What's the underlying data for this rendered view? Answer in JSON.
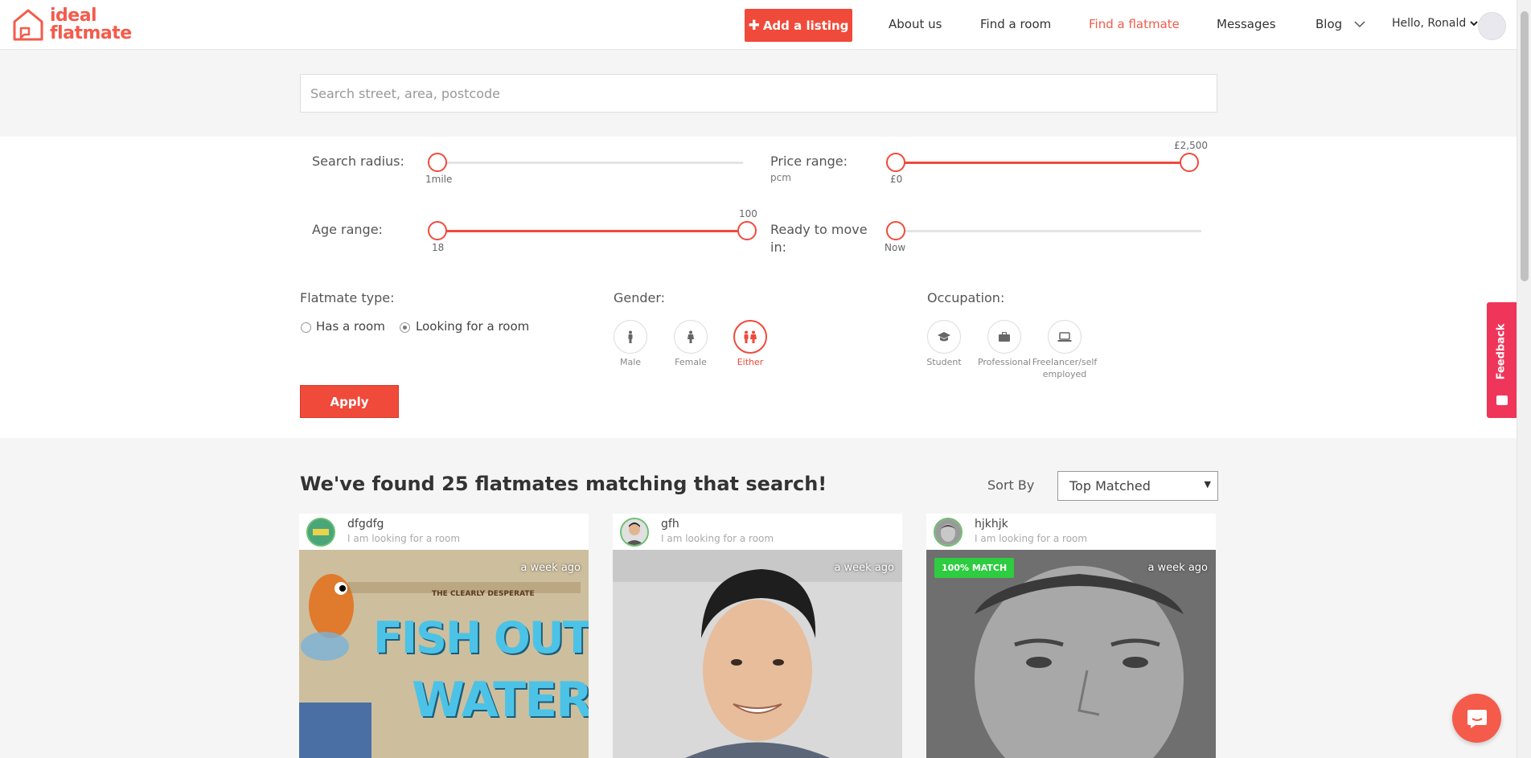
{
  "header": {
    "logo_line1": "ideal",
    "logo_line2": "flatmate",
    "add_listing": "Add a listing",
    "nav": [
      "About us",
      "Find a room",
      "Find a flatmate",
      "Messages",
      "Blog"
    ],
    "active_nav": "Find a flatmate",
    "greeting": "Hello, Ronald"
  },
  "search": {
    "placeholder": "Search street, area, postcode"
  },
  "filters": {
    "radius": {
      "label": "Search radius:",
      "value_label": "1mile",
      "level": 0
    },
    "price": {
      "label": "Price range:",
      "sub": "pcm",
      "min_label": "£0",
      "max_label": "£2,500",
      "min": 0,
      "max": 2500
    },
    "age": {
      "label": "Age range:",
      "min_label": "18",
      "max_label": "100",
      "min": 18,
      "max": 100
    },
    "move_in": {
      "label_line1": "Ready to move",
      "label_line2": "in:",
      "value_label": "Now"
    },
    "flatmate_type": {
      "label": "Flatmate type:",
      "options": [
        "Has a room",
        "Looking for a room"
      ],
      "selected": "Looking for a room"
    },
    "gender": {
      "label": "Gender:",
      "options": [
        "Male",
        "Female",
        "Either"
      ],
      "selected": "Either"
    },
    "occupation": {
      "label": "Occupation:",
      "options": [
        "Student",
        "Professional",
        "Freelancer/self employed"
      ]
    },
    "apply": "Apply"
  },
  "results": {
    "title": "We've found 25 flatmates matching that search!",
    "sort_label": "Sort By",
    "sort_value": "Top Matched",
    "cards": [
      {
        "name": "dfgdfg",
        "status": "I am looking for a room",
        "time": "a week ago",
        "image_text_1": "FISH OUT O",
        "image_text_2": "WATER",
        "image_small": "THE CLEARLY DESPERATE"
      },
      {
        "name": "gfh",
        "status": "I am looking for a room",
        "time": "a week ago"
      },
      {
        "name": "hjkhjk",
        "status": "I am looking for a room",
        "time": "a week ago",
        "match": "100% MATCH"
      }
    ]
  },
  "feedback": "Feedback",
  "colors": {
    "accent": "#f04a3a",
    "match_green": "#2ecc40",
    "feedback_pink": "#f0355a"
  }
}
